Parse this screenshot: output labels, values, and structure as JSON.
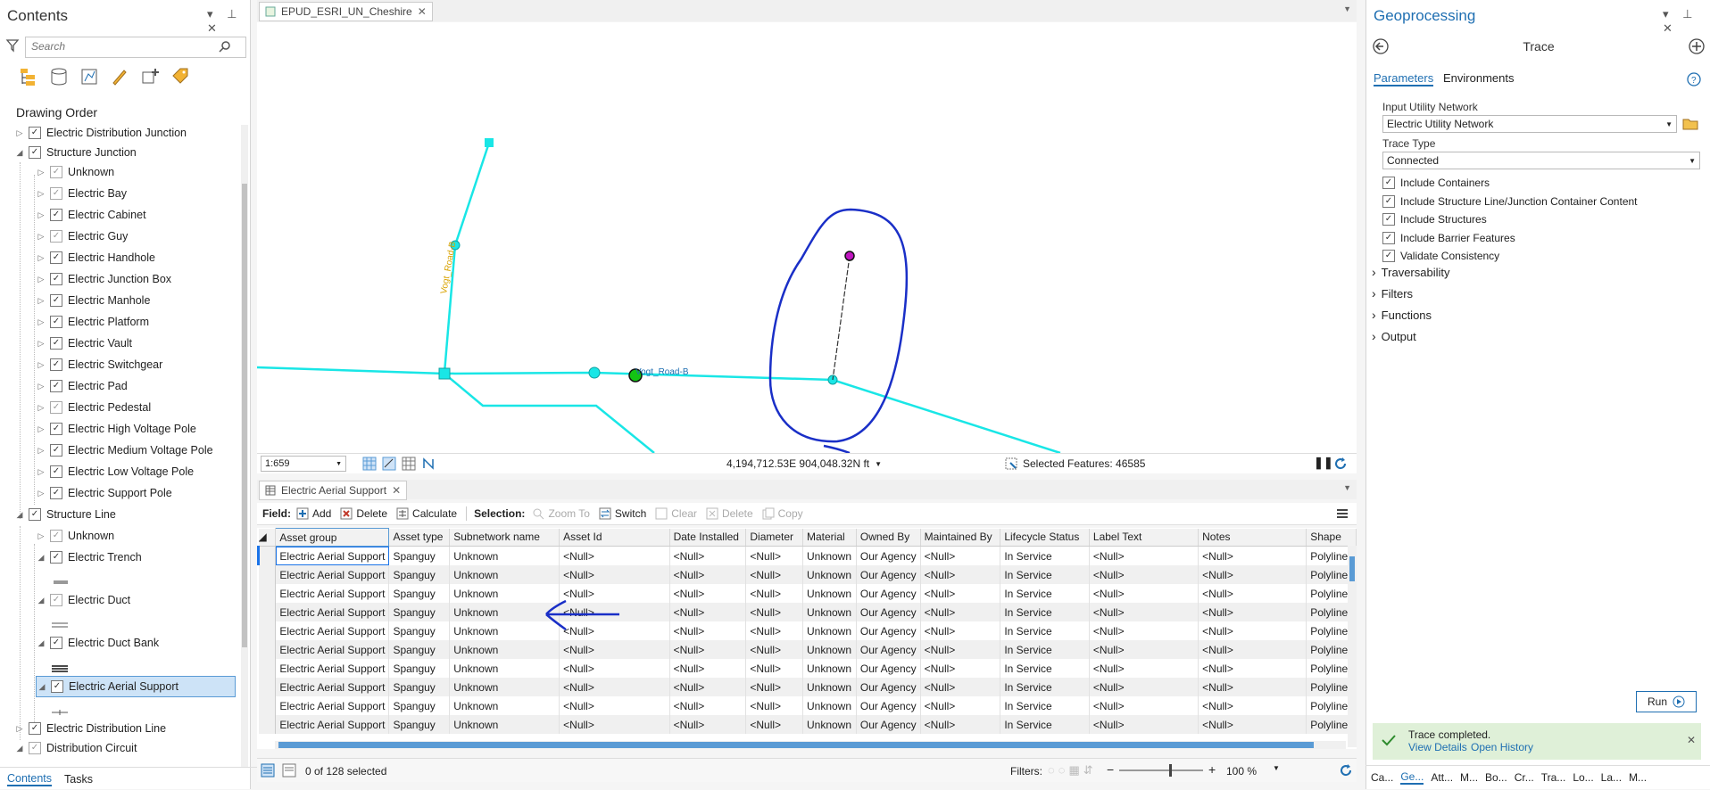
{
  "contents": {
    "title": "Contents",
    "search_placeholder": "Search",
    "section": "Drawing Order",
    "layers": [
      {
        "label": "Electric Distribution Junction"
      },
      {
        "label": "Structure Junction"
      },
      {
        "label": "Unknown"
      },
      {
        "label": "Electric Bay"
      },
      {
        "label": "Electric Cabinet"
      },
      {
        "label": "Electric Guy"
      },
      {
        "label": "Electric Handhole"
      },
      {
        "label": "Electric Junction Box"
      },
      {
        "label": "Electric Manhole"
      },
      {
        "label": "Electric Platform"
      },
      {
        "label": "Electric Vault"
      },
      {
        "label": "Electric Switchgear"
      },
      {
        "label": "Electric Pad"
      },
      {
        "label": "Electric Pedestal"
      },
      {
        "label": "Electric High Voltage Pole"
      },
      {
        "label": "Electric Medium Voltage Pole"
      },
      {
        "label": "Electric Low Voltage Pole"
      },
      {
        "label": "Electric Support Pole"
      },
      {
        "label": "Structure Line"
      },
      {
        "label": "Unknown"
      },
      {
        "label": "Electric Trench"
      },
      {
        "label": "Electric Duct"
      },
      {
        "label": "Electric Duct Bank"
      },
      {
        "label": "Electric Aerial Support"
      },
      {
        "label": "Electric Distribution Line"
      },
      {
        "label": "Distribution Circuit"
      }
    ],
    "bottom_tabs": [
      "Contents",
      "Tasks"
    ]
  },
  "map": {
    "tab_title": "EPUD_ESRI_UN_Cheshire",
    "road_label_1": "Vogt_Road-B",
    "road_label_2": "Vogt_Road-B",
    "scale": "1:659",
    "coordinates": "4,194,712.53E 904,048.32N ft",
    "selected_features": "Selected Features: 46585"
  },
  "table": {
    "tab_title": "Electric Aerial Support",
    "field_label": "Field:",
    "add": "Add",
    "delete": "Delete",
    "calculate": "Calculate",
    "selection_label": "Selection:",
    "zoom_to": "Zoom To",
    "switch": "Switch",
    "clear": "Clear",
    "sel_delete": "Delete",
    "copy": "Copy",
    "columns": [
      "Asset group",
      "Asset type",
      "Subnetwork name",
      "Asset Id",
      "Date Installed",
      "Diameter",
      "Material",
      "Owned By",
      "Maintained By",
      "Lifecycle Status",
      "Label Text",
      "Notes",
      "Shape"
    ],
    "row": [
      "Electric Aerial Support",
      "Spanguy",
      "Unknown",
      "<Null>",
      "<Null>",
      "<Null>",
      "Unknown",
      "Our Agency",
      "<Null>",
      "In Service",
      "<Null>",
      "<Null>",
      "Polyline"
    ],
    "row_count": 10,
    "selection_status": "0 of 128 selected",
    "filters_label": "Filters:",
    "zoom_pct": "100 %"
  },
  "geoprocessing": {
    "title": "Geoprocessing",
    "tool": "Trace",
    "tab_parameters": "Parameters",
    "tab_environments": "Environments",
    "input_un_label": "Input Utility Network",
    "input_un_value": "Electric Utility Network",
    "trace_type_label": "Trace Type",
    "trace_type_value": "Connected",
    "checks": [
      "Include Containers",
      "Include Structure Line/Junction Container Content",
      "Include Structures",
      "Include Barrier Features",
      "Validate Consistency"
    ],
    "groups": [
      "Traversability",
      "Filters",
      "Functions",
      "Output"
    ],
    "run": "Run",
    "message": "Trace completed.",
    "view_details": "View Details",
    "open_history": "Open History",
    "bottom_tabs": [
      "Ca...",
      "Ge...",
      "Att...",
      "M...",
      "Bo...",
      "Cr...",
      "Tra...",
      "Lo...",
      "La...",
      "M..."
    ]
  },
  "colors": {
    "accent": "#1f6fb2",
    "line": "#19e6e6",
    "ink": "#1a2fc7",
    "success": "#dff0d8"
  }
}
